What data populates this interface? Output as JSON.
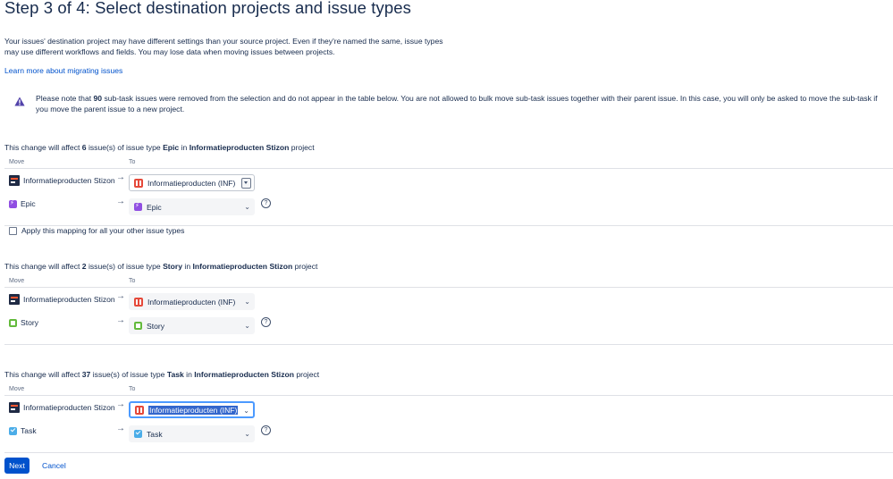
{
  "page": {
    "title": "Step 3 of 4: Select destination projects and issue types",
    "intro": "Your issues' destination project may have different settings than your source project. Even if they're named the same, issue types may use different workflows and fields. You may lose data when moving issues between projects.",
    "learn_more": "Learn more about migrating issues"
  },
  "note": {
    "before": "Please note that ",
    "count": "90",
    "after": " sub-task issues were removed from the selection and do not appear in the table below. You are not allowed to bulk move sub-task issues together with their parent issue. In this case, you will only be asked to move the sub-task if you move the parent issue to a new project."
  },
  "columns": {
    "move": "Move",
    "to": "To"
  },
  "sections": [
    {
      "prefix": "This change will affect ",
      "count": "6",
      "mid": " issue(s) of issue type ",
      "type": "Epic",
      "in": " in ",
      "project": "Informatieproducten Stizon",
      "suffix": " project",
      "source_project": "Informatieproducten Stizon",
      "source_type": "Epic",
      "dest_project": "Informatieproducten (INF)",
      "dest_type": "Epic"
    },
    {
      "prefix": "This change will affect ",
      "count": "2",
      "mid": " issue(s) of issue type ",
      "type": "Story",
      "in": " in ",
      "project": "Informatieproducten Stizon",
      "suffix": " project",
      "source_project": "Informatieproducten Stizon",
      "source_type": "Story",
      "dest_project": "Informatieproducten (INF)",
      "dest_type": "Story"
    },
    {
      "prefix": "This change will affect ",
      "count": "37",
      "mid": " issue(s) of issue type ",
      "type": "Task",
      "in": " in ",
      "project": "Informatieproducten Stizon",
      "suffix": " project",
      "source_project": "Informatieproducten Stizon",
      "source_type": "Task",
      "dest_project": "Informatieproducten (INF)",
      "dest_type": "Task"
    }
  ],
  "apply_mapping": "Apply this mapping for all your other issue types",
  "arrow": "→",
  "help_glyph": "?",
  "buttons": {
    "next": "Next",
    "cancel": "Cancel"
  },
  "colors": {
    "primary": "#0052cc",
    "focus": "#4c9aff",
    "epic": "#904ee2",
    "story": "#63ba3c",
    "task": "#4bade8",
    "warning": "#5243aa"
  }
}
